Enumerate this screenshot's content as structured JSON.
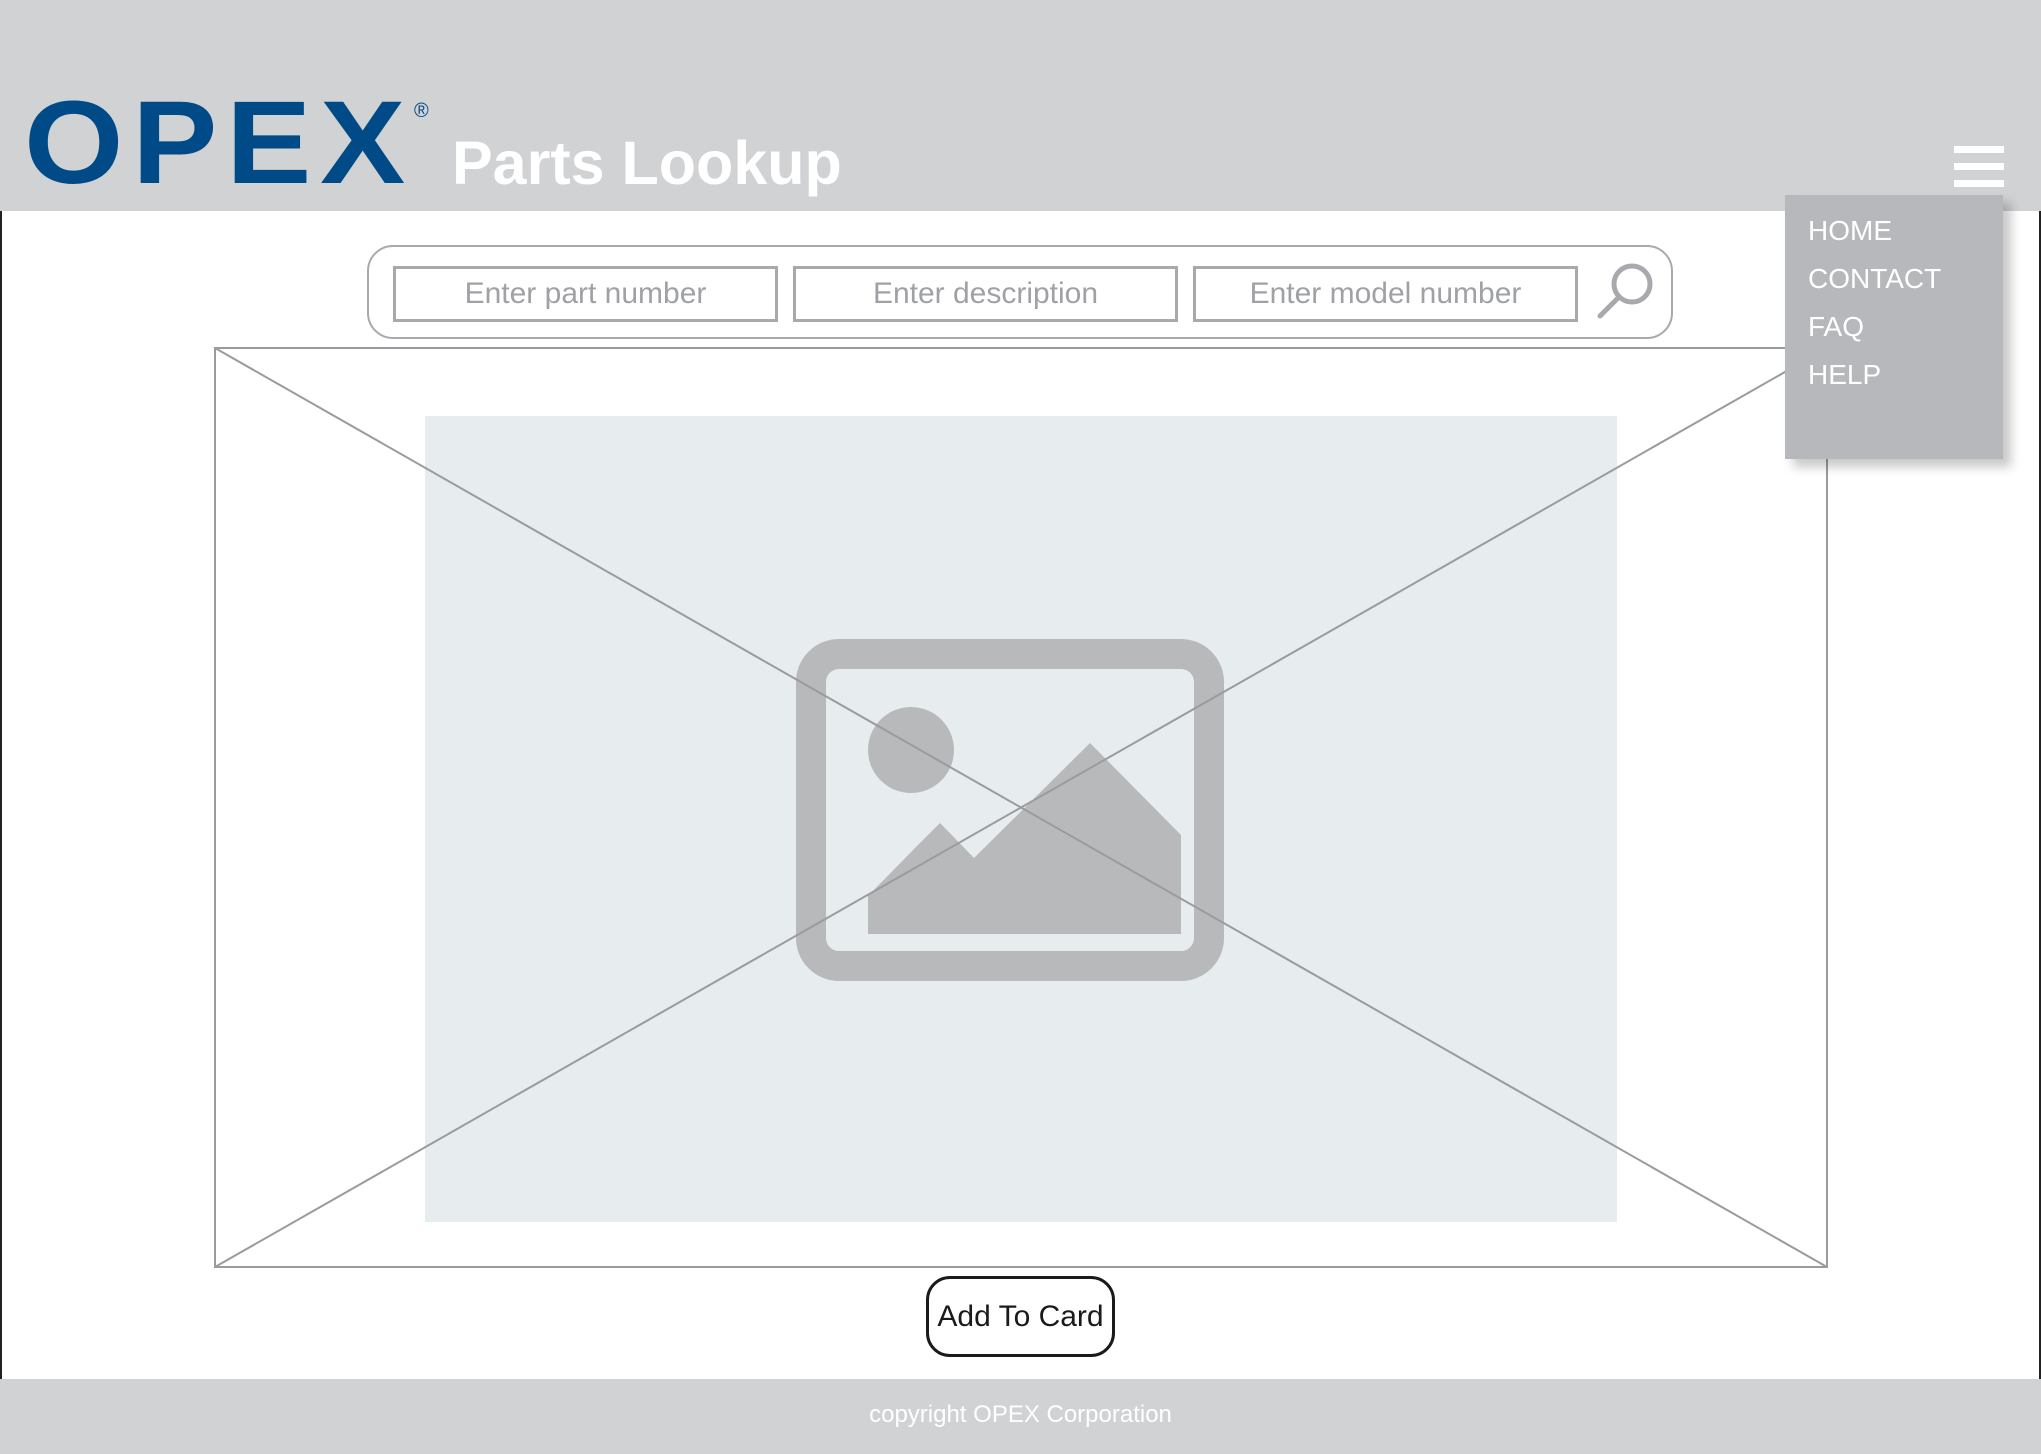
{
  "header": {
    "logo_text": "OPEX",
    "logo_mark": "®",
    "title": "Parts Lookup",
    "menu_icon": "hamburger-menu-icon",
    "brand_color": "#004b87",
    "background_color": "#d1d2d4"
  },
  "search": {
    "part_number_placeholder": "Enter part number",
    "description_placeholder": "Enter description",
    "model_number_placeholder": "Enter model number",
    "search_icon": "magnifying-glass-icon"
  },
  "product_image": {
    "icon": "image-placeholder-icon"
  },
  "actions": {
    "add_label": "Add To Card"
  },
  "menu": {
    "items": [
      {
        "label": "HOME"
      },
      {
        "label": "CONTACT"
      },
      {
        "label": "FAQ"
      },
      {
        "label": "HELP"
      }
    ]
  },
  "footer": {
    "copyright": "copyright OPEX Corporation"
  }
}
